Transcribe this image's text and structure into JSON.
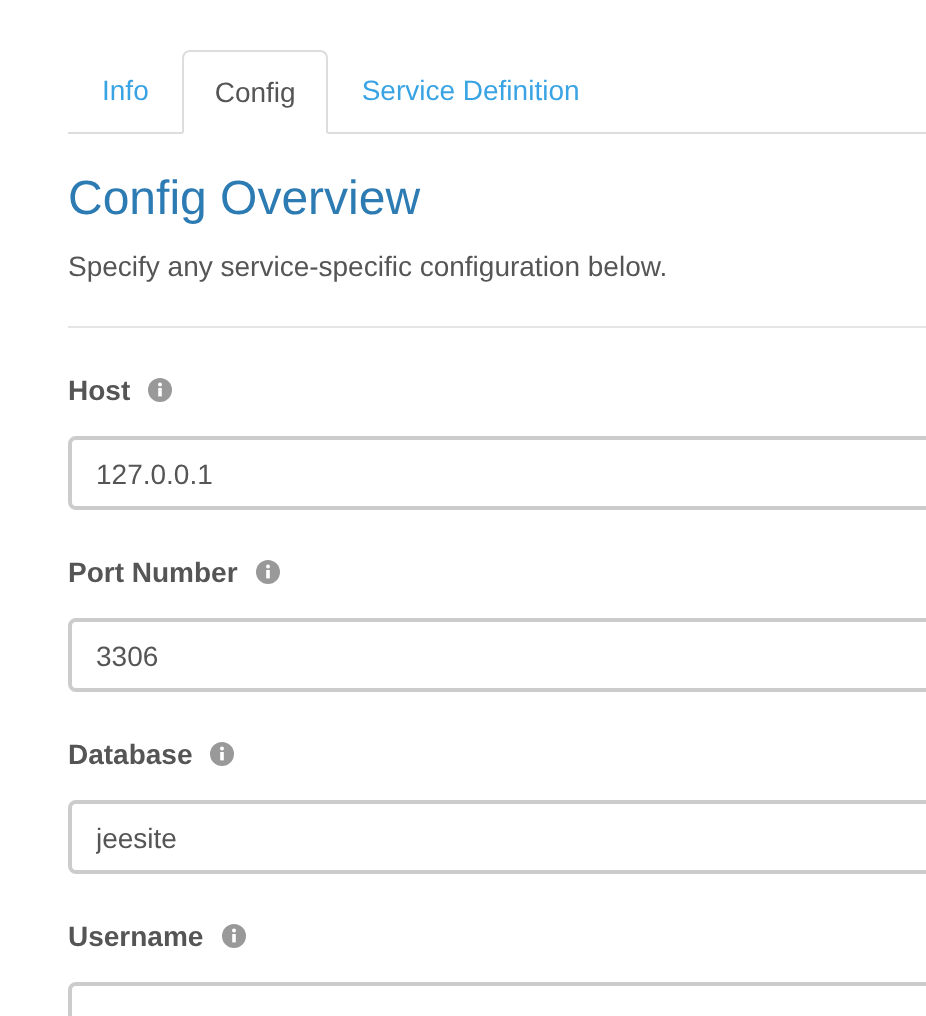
{
  "tabs": [
    {
      "label": "Info",
      "selected": false
    },
    {
      "label": "Config",
      "selected": true
    },
    {
      "label": "Service Definition",
      "selected": false
    }
  ],
  "heading": "Config Overview",
  "description": "Specify any service-specific configuration below.",
  "fields": [
    {
      "label": "Host",
      "value": "127.0.0.1"
    },
    {
      "label": "Port Number",
      "value": "3306"
    },
    {
      "label": "Database",
      "value": "jeesite"
    },
    {
      "label": "Username"
    }
  ]
}
